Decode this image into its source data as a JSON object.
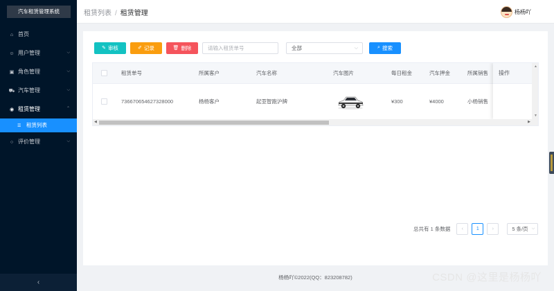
{
  "app": {
    "title": "汽车租赁管理系统"
  },
  "sidebar": {
    "items": [
      {
        "label": "首页",
        "icon": "home-icon",
        "expandable": false
      },
      {
        "label": "用户管理",
        "icon": "users-icon",
        "expandable": true
      },
      {
        "label": "角色管理",
        "icon": "id-card-icon",
        "expandable": true
      },
      {
        "label": "汽车管理",
        "icon": "car-icon",
        "expandable": true
      },
      {
        "label": "租赁管理",
        "icon": "dollar-circle-icon",
        "expandable": true,
        "open": true,
        "children": [
          {
            "label": "租赁列表",
            "icon": "list-icon",
            "active": true
          }
        ]
      },
      {
        "label": "评价管理",
        "icon": "comment-icon",
        "expandable": true
      }
    ],
    "collapse_glyph": "‹"
  },
  "header": {
    "breadcrumb": [
      "租赁列表",
      "租赁管理"
    ],
    "breadcrumb_sep": "/",
    "user_name": "杨杨吖"
  },
  "toolbar": {
    "audit_label": "审核",
    "record_label": "记录",
    "delete_label": "删除",
    "search_placeholder": "请输入租赁单号",
    "select_value": "全部",
    "search_label": "搜索"
  },
  "table": {
    "columns": [
      "租赁单号",
      "所属客户",
      "汽车名称",
      "汽车图片",
      "每日租金",
      "汽车押金",
      "所属销售",
      "操作"
    ],
    "rows": [
      {
        "order_no": "736670654627328000",
        "customer": "杨杨客户",
        "car_name": "起亚智跑沪牌",
        "daily_rent": "¥300",
        "deposit": "¥4000",
        "sales": "小杨销售"
      }
    ]
  },
  "pagination": {
    "total_text": "总共有 1 条数据",
    "current_page": "1",
    "page_size": "5 条/页",
    "prev_glyph": "‹",
    "next_glyph": "›"
  },
  "footer": {
    "text": "杨杨吖©2022(QQ：823208782)"
  },
  "watermark": "CSDN @这里是杨杨吖",
  "colors": {
    "sidebar_bg": "#001529",
    "active_menu": "#1890ff",
    "audit_btn": "#13c2c2",
    "record_btn": "#fa9d0f",
    "delete_btn": "#f5545c",
    "search_btn": "#1890ff"
  }
}
